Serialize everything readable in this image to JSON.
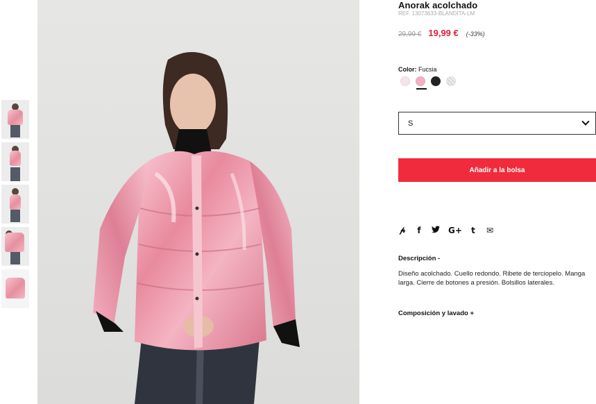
{
  "product": {
    "title": "Anorak acolchado",
    "ref": "REF. 13073633-BLANDITA-LM",
    "old_price": "29,99 €",
    "new_price": "19,99 €",
    "discount": "(-33%)"
  },
  "color": {
    "label": "Color:",
    "selected": "Fucsia",
    "swatches": [
      "#f8e2e6",
      "#f2b2c4",
      "#222222",
      "#e8e8e4"
    ]
  },
  "size": {
    "selected": "S"
  },
  "actions": {
    "add_to_bag": "Añadir a la bolsa"
  },
  "share": {
    "icons": [
      "pinterest-icon",
      "facebook-icon",
      "twitter-icon",
      "google-plus-icon",
      "tumblr-icon",
      "email-icon"
    ],
    "glyphs": [
      "℗",
      "f",
      "🐦",
      "G+",
      "t",
      "✉"
    ]
  },
  "description": {
    "heading": "Descripción -",
    "text": "Diseño acolchado. Cuello redondo. Ribete de terciopelo. Manga larga. Cierre de botones a presión. Bolsillos laterales."
  },
  "composition": {
    "heading": "Composición y lavado +"
  },
  "colors": {
    "accent": "#f02b3b",
    "price": "#e0203a"
  }
}
